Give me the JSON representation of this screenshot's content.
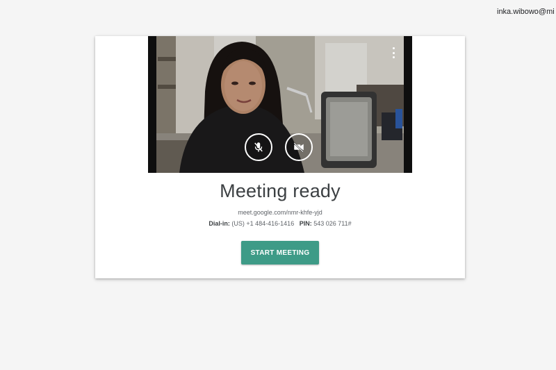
{
  "account": {
    "email": "inka.wibowo@mi"
  },
  "meeting": {
    "title": "Meeting ready",
    "link": "meet.google.com/nmr-khfe-yjd",
    "dialin_label": "Dial-in:",
    "dialin_number": "(US) +1 484-416-1416",
    "pin_label": "PIN:",
    "pin_value": "543 026 711#",
    "start_label": "START MEETING"
  },
  "controls": {
    "mic_icon": "mic-off-icon",
    "camera_icon": "videocam-off-icon",
    "more_icon": "more-vert-icon"
  },
  "colors": {
    "primary": "#3e9b87",
    "background": "#f5f5f5",
    "card": "#ffffff"
  }
}
